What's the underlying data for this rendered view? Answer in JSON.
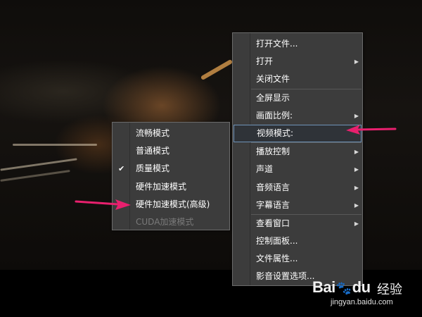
{
  "main_menu": {
    "items": [
      {
        "label": "打开文件...",
        "submenu": false
      },
      {
        "label": "打开",
        "submenu": true
      },
      {
        "label": "关闭文件",
        "submenu": false
      },
      {
        "label": "全屏显示",
        "submenu": false
      },
      {
        "label": "画面比例:",
        "submenu": true
      },
      {
        "label": "视频模式:",
        "submenu": false,
        "highlighted": true
      },
      {
        "label": "播放控制",
        "submenu": true
      },
      {
        "label": "声道",
        "submenu": true
      },
      {
        "label": "音频语言",
        "submenu": true
      },
      {
        "label": "字幕语言",
        "submenu": true
      },
      {
        "label": "查看窗口",
        "submenu": true
      },
      {
        "label": "控制面板...",
        "submenu": false
      },
      {
        "label": "文件属性...",
        "submenu": false
      },
      {
        "label": "影音设置选项...",
        "submenu": false
      }
    ],
    "submenu_arrow": "▶"
  },
  "video_mode_submenu": {
    "items": [
      {
        "label": "流畅模式",
        "checked": false,
        "enabled": true
      },
      {
        "label": "普通模式",
        "checked": false,
        "enabled": true
      },
      {
        "label": "质量模式",
        "checked": true,
        "enabled": true
      },
      {
        "label": "硬件加速模式",
        "checked": false,
        "enabled": true
      },
      {
        "label": "硬件加速模式(高级)",
        "checked": false,
        "enabled": true
      },
      {
        "label": "CUDA加速模式",
        "checked": false,
        "enabled": false
      }
    ],
    "check_mark": "✔"
  },
  "annotations": {
    "arrow_color": "#e8206e"
  },
  "watermark": {
    "logo_left": "Bai",
    "logo_paw": "🐾",
    "logo_right": "du",
    "cn": "经验",
    "url": "jingyan.baidu.com"
  }
}
